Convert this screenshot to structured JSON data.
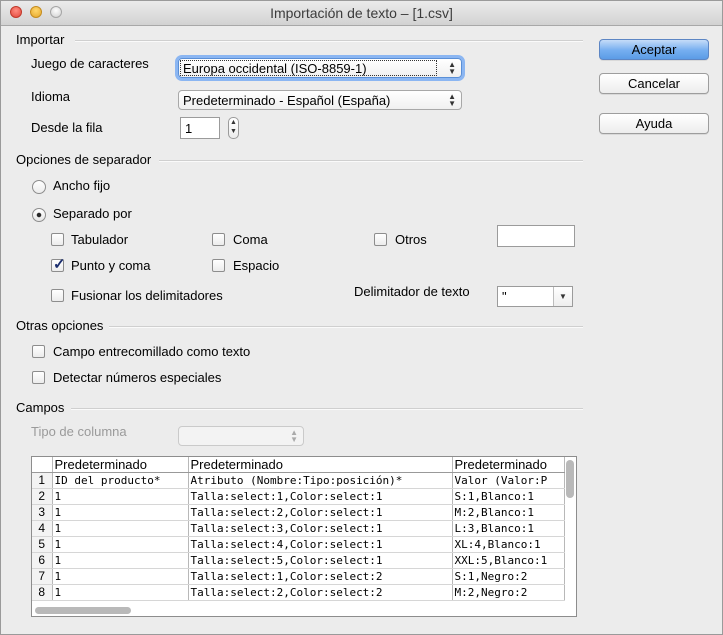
{
  "window": {
    "title": "Importación de texto – [1.csv]"
  },
  "import": {
    "section": "Importar",
    "charset_label": "Juego de caracteres",
    "charset_value": "Europa occidental (ISO-8859-1)",
    "language_label": "Idioma",
    "language_value": "Predeterminado - Español (España)",
    "from_row_label": "Desde la fila",
    "from_row_value": "1"
  },
  "buttons": {
    "accept": "Aceptar",
    "cancel": "Cancelar",
    "help": "Ayuda"
  },
  "separator": {
    "section": "Opciones de separador",
    "fixed_width": "Ancho fijo",
    "separated_by": "Separado por",
    "selected_mode": "separated_by",
    "tab": {
      "label": "Tabulador",
      "checked": false
    },
    "comma": {
      "label": "Coma",
      "checked": false
    },
    "other": {
      "label": "Otros",
      "checked": false,
      "value": ""
    },
    "semicolon": {
      "label": "Punto y coma",
      "checked": true
    },
    "space": {
      "label": "Espacio",
      "checked": false
    },
    "merge": {
      "label": "Fusionar los delimitadores",
      "checked": false
    },
    "text_delimiter_label": "Delimitador de texto",
    "text_delimiter_value": "\""
  },
  "other_options": {
    "section": "Otras opciones",
    "quoted_as_text": {
      "label": "Campo entrecomillado como texto",
      "checked": false
    },
    "detect_special": {
      "label": "Detectar números especiales",
      "checked": false
    }
  },
  "fields": {
    "section": "Campos",
    "column_type_label": "Tipo de columna",
    "column_type_value": "",
    "headers": [
      "Predeterminado",
      "Predeterminado",
      "Predeterminado"
    ],
    "rows": [
      {
        "n": "1",
        "c": [
          "ID del producto*",
          "Atributo (Nombre:Tipo:posición)*",
          "Valor (Valor:P"
        ]
      },
      {
        "n": "2",
        "c": [
          "1",
          "Talla:select:1,Color:select:1",
          "S:1,Blanco:1"
        ]
      },
      {
        "n": "3",
        "c": [
          "1",
          "Talla:select:2,Color:select:1",
          "M:2,Blanco:1"
        ]
      },
      {
        "n": "4",
        "c": [
          "1",
          "Talla:select:3,Color:select:1",
          "L:3,Blanco:1"
        ]
      },
      {
        "n": "5",
        "c": [
          "1",
          "Talla:select:4,Color:select:1",
          "XL:4,Blanco:1"
        ]
      },
      {
        "n": "6",
        "c": [
          "1",
          "Talla:select:5,Color:select:1",
          "XXL:5,Blanco:1"
        ]
      },
      {
        "n": "7",
        "c": [
          "1",
          "Talla:select:1,Color:select:2",
          "S:1,Negro:2"
        ]
      },
      {
        "n": "8",
        "c": [
          "1",
          "Talla:select:2,Color:select:2",
          "M:2,Negro:2"
        ]
      }
    ]
  },
  "icons": {
    "accent": "#5b9ce6",
    "check_color": "#1b2e6e"
  }
}
